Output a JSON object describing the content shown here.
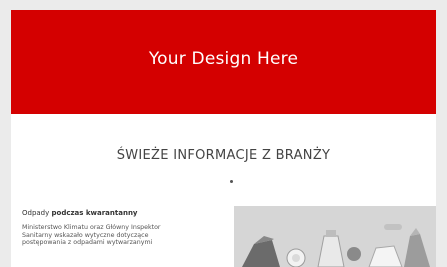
{
  "banner": {
    "text": "Your Design Here",
    "color": "#d40000"
  },
  "section": {
    "title": "ŚWIEŻE INFORMACJE Z BRANŻY"
  },
  "article": {
    "title_plain": "Odpady ",
    "title_bold": "podczas kwarantanny",
    "body_lines": [
      "Ministerstwo Klimatu oraz Główny Inspektor",
      "Sanitarny wskazało wytyczne dotyczące",
      "postępowania z odpadami wytwarzanymi"
    ]
  }
}
